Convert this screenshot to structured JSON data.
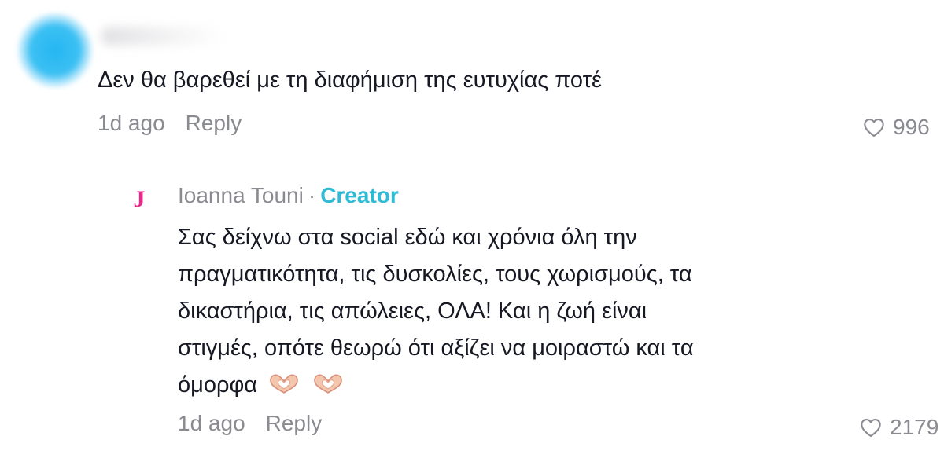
{
  "comment": {
    "text": "Δεν θα βαρεθεί με τη διαφήμιση της ευτυχίας ποτέ",
    "time": "1d ago",
    "reply_label": "Reply",
    "likes": "996"
  },
  "reply": {
    "avatar_letter": "J",
    "author": "Ioanna Touni",
    "separator": "·",
    "badge": "Creator",
    "lines": [
      "Σας δείχνω στα social εδώ και χρόνια όλη την",
      "πραγματικότητα, τις δυσκολίες, τους χωρισμούς, τα",
      "δικαστήρια, τις απώλειες, ΟΛΑ! Και η ζωή είναι",
      "στιγμές, οπότε θεωρώ ότι αξίζει να μοιραστώ και τα",
      "όμορφα"
    ],
    "time": "1d ago",
    "reply_label": "Reply",
    "likes": "2179"
  },
  "icons": {
    "like": "heart-outline-icon",
    "emoji": "heart-hands-emoji"
  },
  "colors": {
    "text": "#161823",
    "secondary": "#8a8b91",
    "creator_badge": "#2ebbd6",
    "avatar_letter": "#e9288a",
    "blurred_avatar": "#25b6f1"
  }
}
